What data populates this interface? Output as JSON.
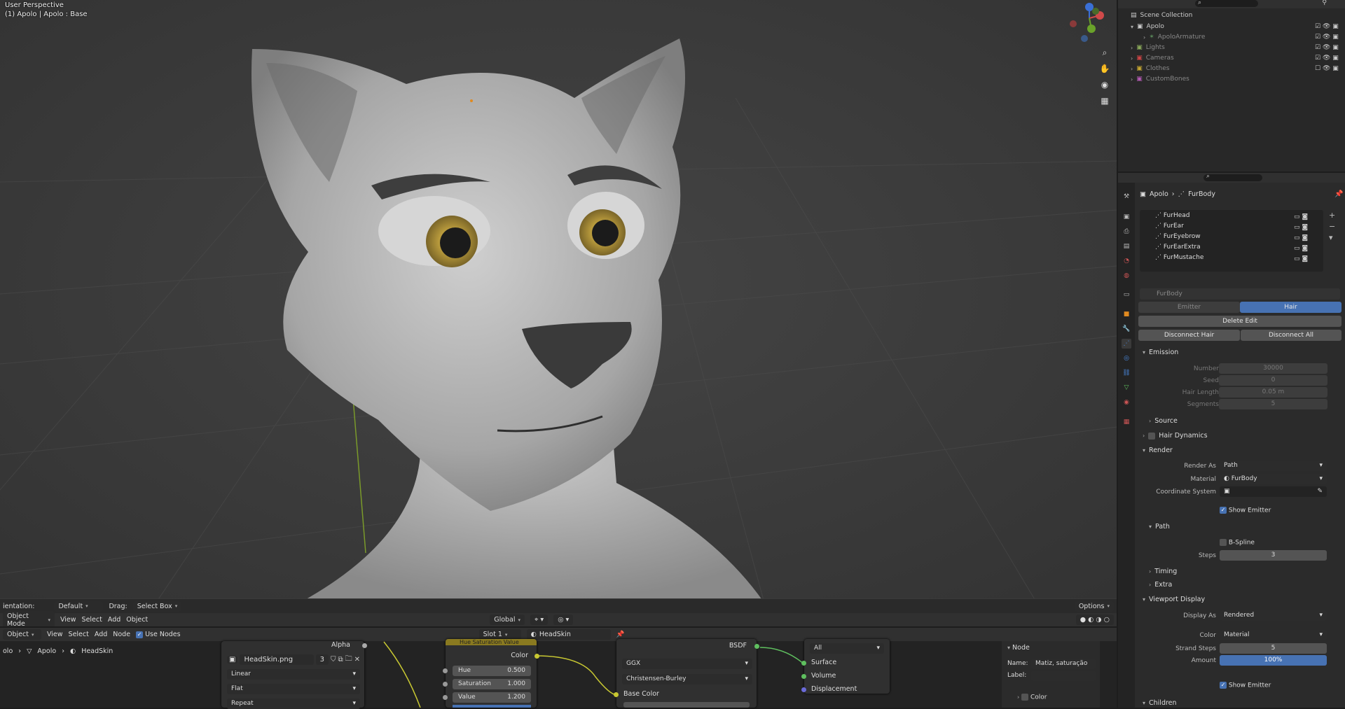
{
  "viewport": {
    "title": "User Perspective",
    "subtitle": "(1) Apolo | Apolo : Base",
    "header": {
      "orientation_label": "ientation:",
      "orientation_value": "Default",
      "drag_label": "Drag:",
      "drag_value": "Select Box",
      "options_label": "Options"
    },
    "menu": {
      "mode": "Object Mode",
      "items": [
        "View",
        "Select",
        "Add",
        "Object"
      ],
      "transform": "Global"
    },
    "nav_icons": [
      "zoom-icon",
      "hand-pan-icon",
      "camera-icon",
      "grid-icon"
    ]
  },
  "outliner": {
    "title": "Scene Collection",
    "items": [
      {
        "label": "Apolo",
        "level": 0
      },
      {
        "label": "ApoloArmature",
        "level": 1
      },
      {
        "label": "Lights",
        "level": 0
      },
      {
        "label": "Cameras",
        "level": 0
      },
      {
        "label": "Clothes",
        "level": 0
      },
      {
        "label": "CustomBones",
        "level": 0
      }
    ]
  },
  "properties": {
    "breadcrumb": [
      "Apolo",
      "FurBody"
    ],
    "particle_systems": [
      "FurHead",
      "FurEar",
      "FurEyebrow",
      "FurEarExtra",
      "FurMustache"
    ],
    "system_name": "FurBody",
    "tabs": {
      "emitter": "Emitter",
      "hair": "Hair"
    },
    "buttons": {
      "delete_edit": "Delete Edit",
      "disconnect_hair": "Disconnect Hair",
      "disconnect_all": "Disconnect All"
    },
    "emission": {
      "title": "Emission",
      "fields": [
        {
          "label": "Number",
          "value": "30000"
        },
        {
          "label": "Seed",
          "value": "0"
        },
        {
          "label": "Hair Length",
          "value": "0.05 m"
        },
        {
          "label": "Segments",
          "value": "5"
        }
      ]
    },
    "source_title": "Source",
    "hair_dynamics_title": "Hair Dynamics",
    "render": {
      "title": "Render",
      "render_as_label": "Render As",
      "render_as_value": "Path",
      "material_label": "Material",
      "material_value": "FurBody",
      "coord_label": "Coordinate System",
      "show_emitter": "Show Emitter",
      "path_title": "Path",
      "bspline": "B-Spline",
      "steps_label": "Steps",
      "steps_value": "3",
      "timing_title": "Timing",
      "extra_title": "Extra"
    },
    "viewport_display": {
      "title": "Viewport Display",
      "display_as_label": "Display As",
      "display_as_value": "Rendered",
      "color_label": "Color",
      "color_value": "Material",
      "strand_steps_label": "Strand Steps",
      "strand_steps_value": "5",
      "amount_label": "Amount",
      "amount_value": "100%",
      "show_emitter": "Show Emitter"
    },
    "children_title": "Children"
  },
  "node_editor": {
    "header": {
      "mode": "Object",
      "items": [
        "View",
        "Select",
        "Add",
        "Node"
      ],
      "use_nodes": "Use Nodes",
      "slot": "Slot 1",
      "material": "HeadSkin"
    },
    "breadcrumb": [
      "olo",
      "Apolo",
      "HeadSkin"
    ],
    "image_node": {
      "alpha": "Alpha",
      "image": "HeadSkin.png",
      "users": "3",
      "interpolation": "Linear",
      "projection": "Flat",
      "extension": "Repeat"
    },
    "hsv_node": {
      "title": "Hue Saturation Value",
      "color_out": "Color",
      "hue_label": "Hue",
      "hue_value": "0.500",
      "saturation_label": "Saturation",
      "saturation_value": "1.000",
      "value_label": "Value",
      "value_value": "1.200"
    },
    "bsdf_node": {
      "bsdf_out": "BSDF",
      "distribution": "GGX",
      "subsurface": "Christensen-Burley",
      "base_color": "Base Color"
    },
    "output_node": {
      "target": "All",
      "surface": "Surface",
      "volume": "Volume",
      "displacement": "Displacement"
    },
    "sidebar": {
      "title": "Node",
      "name_label": "Name:",
      "name_value": "Matiz, saturação ...",
      "label_label": "Label:",
      "color_label": "Color"
    }
  },
  "colors": {
    "accent": "#4772b3",
    "viewport_bg": "#3a3a3a",
    "panel_bg": "#2b2b2b"
  }
}
